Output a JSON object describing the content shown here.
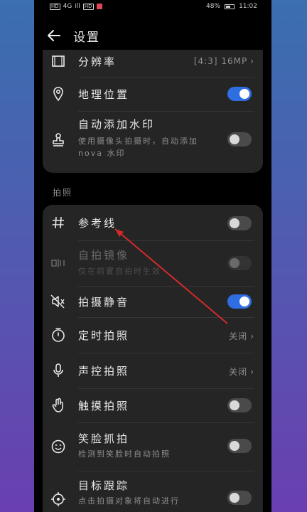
{
  "status": {
    "left_chips": [
      "HD",
      "4G",
      "ill",
      "HD"
    ],
    "battery": "48%",
    "time": "11:02"
  },
  "appbar": {
    "title": "设置"
  },
  "section_label": "拍照",
  "rows": {
    "resolution": {
      "label": "分辨率",
      "value": "[4:3] 16MP"
    },
    "location": {
      "label": "地理位置",
      "on": true
    },
    "watermark": {
      "label": "自动添加水印",
      "sub": "使用摄像头拍摄时，自动添加 nova 水印",
      "on": false
    },
    "gridlines": {
      "label": "参考线",
      "on": false
    },
    "mirror": {
      "label": "自拍镜像",
      "sub": "仅在前置自拍时生效",
      "on": false
    },
    "mute": {
      "label": "拍摄静音",
      "on": true
    },
    "timer": {
      "label": "定时拍照",
      "value": "关闭"
    },
    "audio": {
      "label": "声控拍照",
      "value": "关闭"
    },
    "touch": {
      "label": "触摸拍照",
      "on": false
    },
    "smile": {
      "label": "笑脸抓拍",
      "sub": "检测到笑脸时自动拍照",
      "on": false
    },
    "tracking": {
      "label": "目标跟踪",
      "sub": "点击拍摄对象将自动进行",
      "on": false
    }
  },
  "colors": {
    "accent": "#2f6ee0",
    "annotation_arrow": "#d42a2a"
  }
}
